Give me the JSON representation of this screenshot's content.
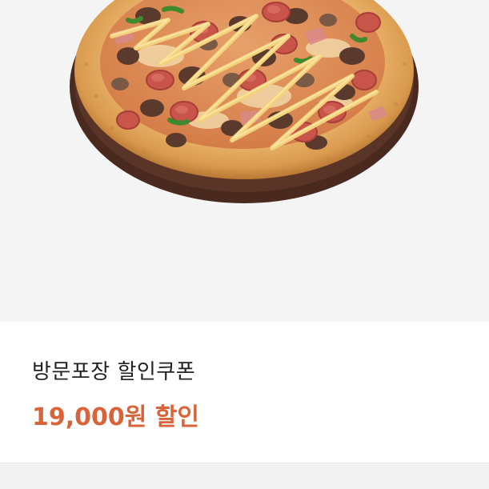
{
  "product": {
    "image_icon": "pizza-image",
    "coupon_title": "방문포장 할인쿠폰",
    "discount_label": "19,000원 할인"
  },
  "colors": {
    "accent": "#d9643a",
    "title": "#222222",
    "card_bg": "#ffffff",
    "page_bg": "#f4f4f4"
  }
}
